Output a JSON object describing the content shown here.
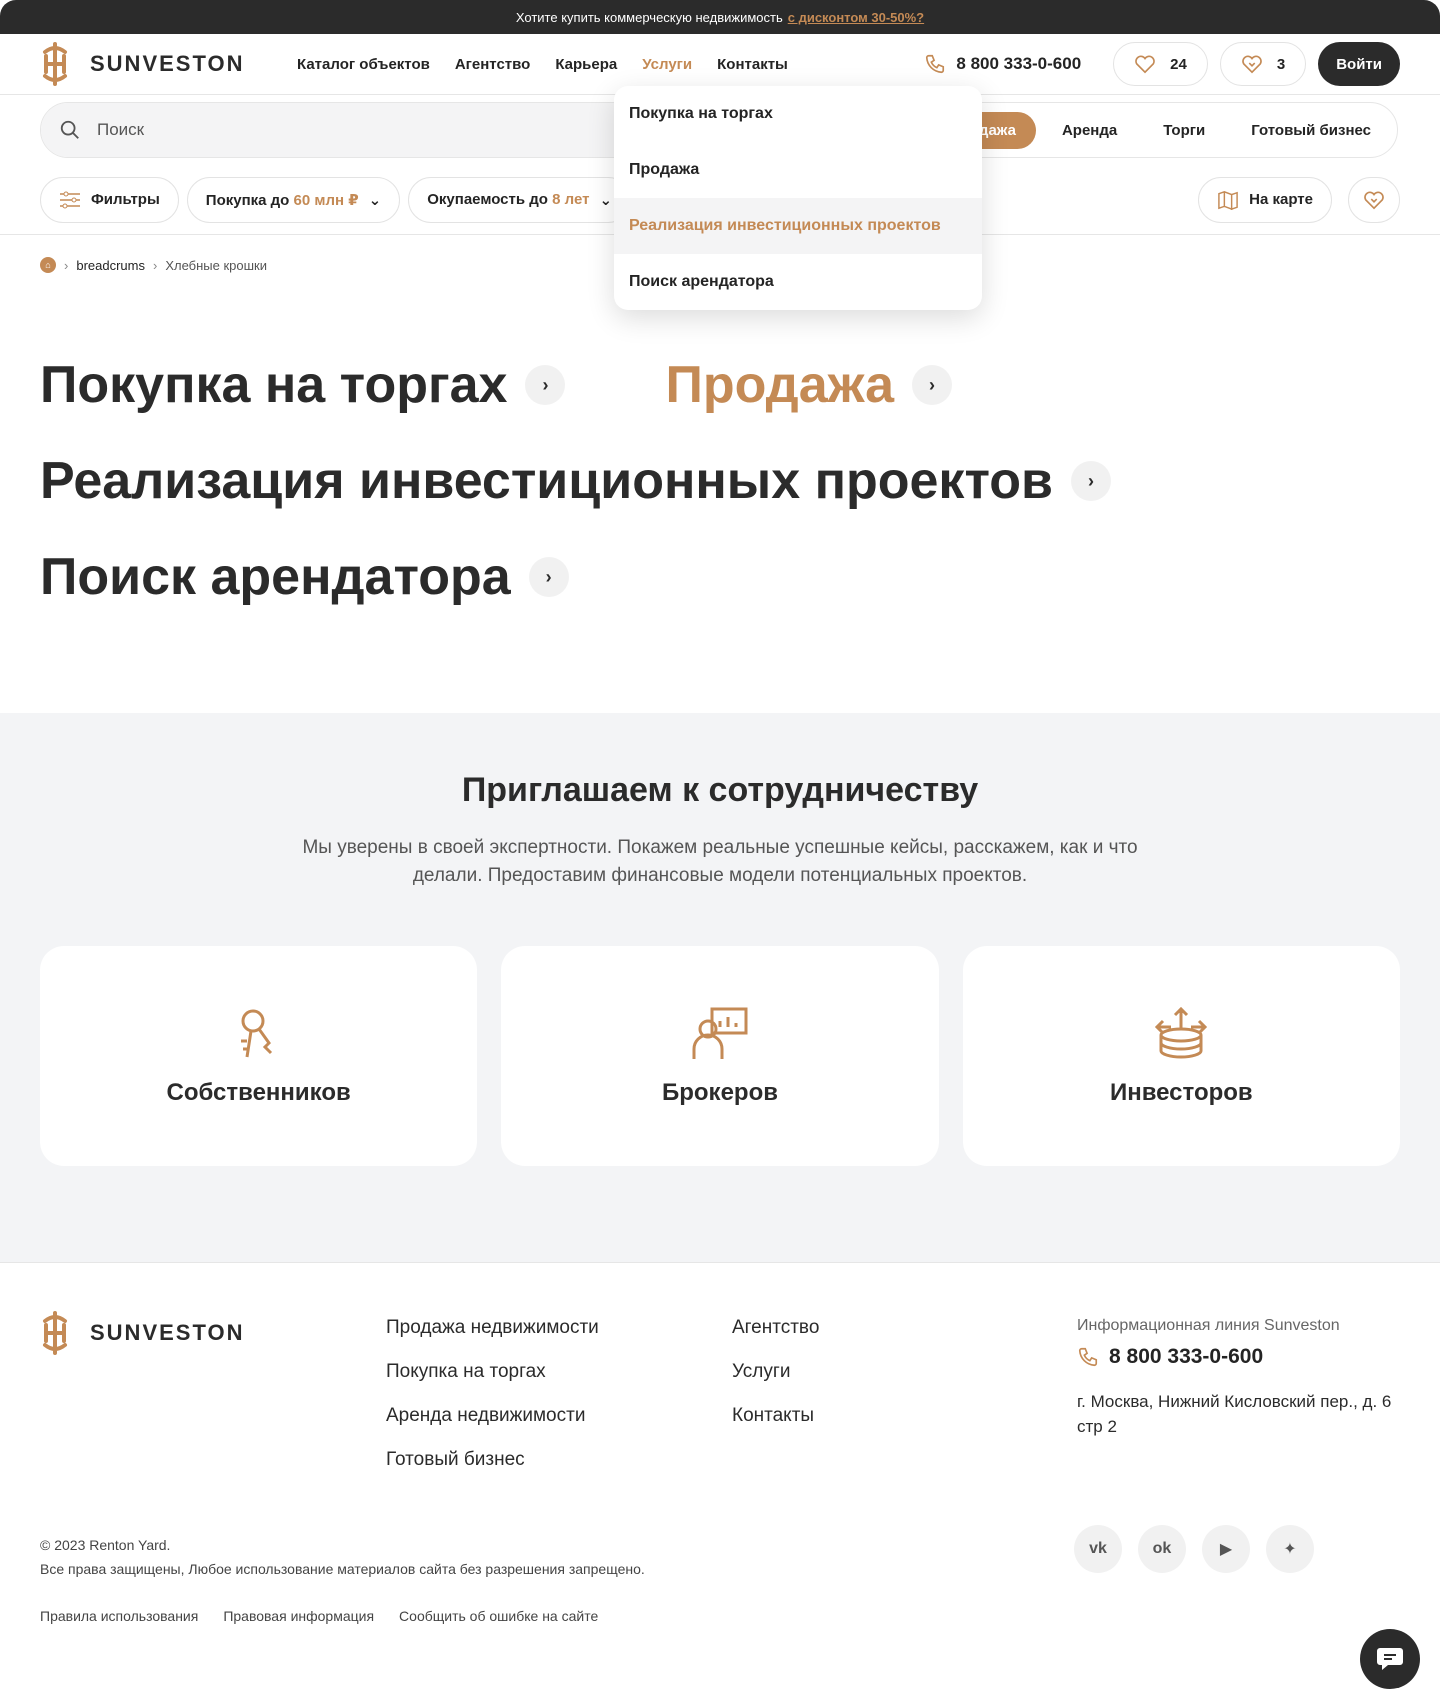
{
  "promo": {
    "text": "Хотите купить коммерческую недвижимость",
    "link": "с дисконтом 30-50%?"
  },
  "header": {
    "brand": "SUNVESTON",
    "nav": [
      "Каталог объектов",
      "Агентство",
      "Карьера",
      "Услуги",
      "Контакты"
    ],
    "active_nav": "Услуги",
    "phone": "8 800 333-0-600",
    "favorites_count": "24",
    "compare_count": "3",
    "login": "Войти"
  },
  "search": {
    "placeholder": "Поиск",
    "tabs": [
      "Продажа",
      "Аренда",
      "Торги",
      "Готовый бизнес"
    ],
    "selected_tab": "Продажа"
  },
  "filters": {
    "filters_label": "Фильтры",
    "price_prefix": "Покупка до",
    "price_value": "60 млн ₽",
    "payback_prefix": "Окупаемость до",
    "payback_value": "8 лет",
    "map_label": "На карте"
  },
  "dropdown": {
    "items": [
      "Покупка на торгах",
      "Продажа",
      "Реализация инвестиционных проектов",
      "Поиск арендатора"
    ],
    "highlighted": "Реализация инвестиционных проектов"
  },
  "breadcrumbs": [
    "breadcrums",
    "Хлебные крошки"
  ],
  "services": {
    "items": [
      "Покупка на торгах",
      "Продажа",
      "Реализация инвестиционных проектов",
      "Поиск арендатора"
    ],
    "accent_item": "Продажа"
  },
  "cooperation": {
    "title": "Приглашаем к сотрудничеству",
    "text": "Мы уверены в своей экспертности. Покажем реальные успешные кейсы, расскажем, как и что делали. Предоставим финансовые модели потенциальных проектов.",
    "cards": [
      {
        "label": "Собственников",
        "icon": "owner-keys-icon"
      },
      {
        "label": "Брокеров",
        "icon": "broker-presentation-icon"
      },
      {
        "label": "Инвесторов",
        "icon": "investor-coins-icon"
      }
    ]
  },
  "footer": {
    "brand": "SUNVESTON",
    "col1": [
      "Продажа недвижимости",
      "Покупка на торгах",
      "Аренда недвижимости",
      "Готовый бизнес"
    ],
    "col2": [
      "Агентство",
      "Услуги",
      "Контакты"
    ],
    "info_label": "Информационная линия Sunveston",
    "phone": "8 800 333-0-600",
    "address": "г. Москва, Нижний Кисловский пер., д. 6 стр 2",
    "copyright": "© 2023 Renton Yard.",
    "rights": "Все права защищены, Любое использование материалов сайта без разрешения запрещено.",
    "legal_links": [
      "Правила использования",
      "Правовая информация",
      "Сообщить об ошибке на сайте"
    ],
    "social": [
      "vk-icon",
      "odnoklassniki-icon",
      "youtube-icon",
      "zen-icon"
    ]
  },
  "colors": {
    "accent": "#c48a55",
    "dark": "#2b2b2b",
    "light_bg": "#f3f4f6"
  }
}
